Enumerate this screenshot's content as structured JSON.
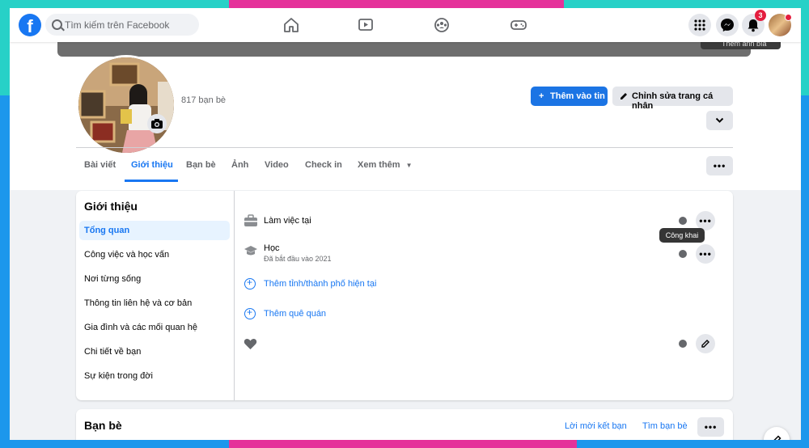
{
  "search": {
    "placeholder": "Tìm kiếm trên Facebook"
  },
  "notifications": {
    "count": "3"
  },
  "cover": {
    "button_label": "Thêm ảnh bìa"
  },
  "profile": {
    "friends_count": "817 bạn bè"
  },
  "actions": {
    "add_story": "Thêm vào tin",
    "edit_profile": "Chỉnh sửa trang cá nhân"
  },
  "tabs": [
    {
      "label": "Bài viết"
    },
    {
      "label": "Giới thiệu"
    },
    {
      "label": "Bạn bè"
    },
    {
      "label": "Ảnh"
    },
    {
      "label": "Video"
    },
    {
      "label": "Check in"
    },
    {
      "label": "Xem thêm"
    }
  ],
  "about": {
    "title": "Giới thiệu",
    "menu": [
      {
        "label": "Tổng quan"
      },
      {
        "label": "Công việc và học vấn"
      },
      {
        "label": "Nơi từng sống"
      },
      {
        "label": "Thông tin liên hệ và cơ bản"
      },
      {
        "label": "Gia đình và các mối quan hệ"
      },
      {
        "label": "Chi tiết về bạn"
      },
      {
        "label": "Sự kiện trong đời"
      }
    ],
    "work": "Làm việc tại",
    "study": "Học",
    "study_sub": "Đã bắt đầu vào 2021",
    "add_city": "Thêm tỉnh/thành phố hiện tại",
    "add_hometown": "Thêm quê quán",
    "tooltip": "Công khai"
  },
  "friends": {
    "title": "Bạn bè",
    "requests": "Lời mời kết bạn",
    "find": "Tìm bạn bè"
  },
  "colors": {
    "brand": "#1877f2",
    "frame_teal": "#27d1c7",
    "frame_pink": "#e5329a",
    "frame_blue": "#1c97ec"
  }
}
